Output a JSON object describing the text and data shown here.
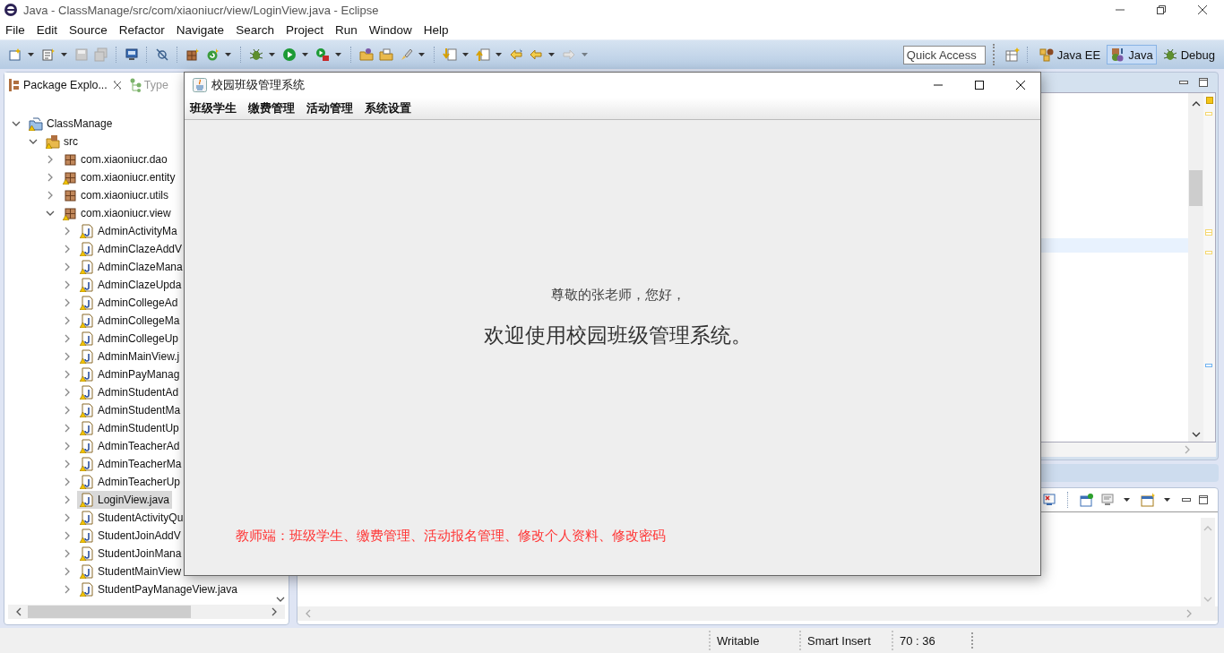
{
  "window": {
    "title": "Java - ClassManage/src/com/xiaoniucr/view/LoginView.java - Eclipse"
  },
  "menu_bar": [
    "File",
    "Edit",
    "Source",
    "Refactor",
    "Navigate",
    "Search",
    "Project",
    "Run",
    "Window",
    "Help"
  ],
  "quick_access": {
    "placeholder": "Quick Access"
  },
  "perspectives": [
    {
      "label": "Java EE",
      "selected": false
    },
    {
      "label": "Java",
      "selected": true
    },
    {
      "label": "Debug",
      "selected": false
    }
  ],
  "package_explorer": {
    "tabs": [
      {
        "label": "Package Explo...",
        "selected": true
      },
      {
        "label": "Type",
        "selected": false
      }
    ],
    "tree": [
      {
        "label": "ClassManage",
        "kind": "project",
        "expanded": true,
        "selected": false,
        "children": [
          {
            "label": "src",
            "kind": "folder",
            "expanded": true,
            "selected": false,
            "children": [
              {
                "label": "com.xiaoniucr.dao",
                "kind": "package",
                "expanded": false,
                "selected": false
              },
              {
                "label": "com.xiaoniucr.entity",
                "kind": "package",
                "expanded": false,
                "selected": false
              },
              {
                "label": "com.xiaoniucr.utils",
                "kind": "package",
                "expanded": false,
                "selected": false
              },
              {
                "label": "com.xiaoniucr.view",
                "kind": "package",
                "expanded": true,
                "selected": false,
                "children": [
                  {
                    "label": "AdminActivityMa",
                    "kind": "file",
                    "expanded": false,
                    "selected": false
                  },
                  {
                    "label": "AdminClazeAddV",
                    "kind": "file",
                    "expanded": false,
                    "selected": false
                  },
                  {
                    "label": "AdminClazeMana",
                    "kind": "file",
                    "expanded": false,
                    "selected": false
                  },
                  {
                    "label": "AdminClazeUpda",
                    "kind": "file",
                    "expanded": false,
                    "selected": false
                  },
                  {
                    "label": "AdminCollegeAd",
                    "kind": "file",
                    "expanded": false,
                    "selected": false
                  },
                  {
                    "label": "AdminCollegeMa",
                    "kind": "file",
                    "expanded": false,
                    "selected": false
                  },
                  {
                    "label": "AdminCollegeUp",
                    "kind": "file",
                    "expanded": false,
                    "selected": false
                  },
                  {
                    "label": "AdminMainView.j",
                    "kind": "file",
                    "expanded": false,
                    "selected": false
                  },
                  {
                    "label": "AdminPayManag",
                    "kind": "file",
                    "expanded": false,
                    "selected": false
                  },
                  {
                    "label": "AdminStudentAd",
                    "kind": "file",
                    "expanded": false,
                    "selected": false
                  },
                  {
                    "label": "AdminStudentMa",
                    "kind": "file",
                    "expanded": false,
                    "selected": false
                  },
                  {
                    "label": "AdminStudentUp",
                    "kind": "file",
                    "expanded": false,
                    "selected": false
                  },
                  {
                    "label": "AdminTeacherAd",
                    "kind": "file",
                    "expanded": false,
                    "selected": false
                  },
                  {
                    "label": "AdminTeacherMa",
                    "kind": "file",
                    "expanded": false,
                    "selected": false
                  },
                  {
                    "label": "AdminTeacherUp",
                    "kind": "file",
                    "expanded": false,
                    "selected": false
                  },
                  {
                    "label": "LoginView.java",
                    "kind": "file",
                    "expanded": false,
                    "selected": true
                  },
                  {
                    "label": "StudentActivityQu",
                    "kind": "file",
                    "expanded": false,
                    "selected": false
                  },
                  {
                    "label": "StudentJoinAddV",
                    "kind": "file",
                    "expanded": false,
                    "selected": false
                  },
                  {
                    "label": "StudentJoinMana",
                    "kind": "file",
                    "expanded": false,
                    "selected": false
                  },
                  {
                    "label": "StudentMainView",
                    "kind": "file",
                    "expanded": false,
                    "selected": false
                  },
                  {
                    "label": "StudentPayManageView.java",
                    "kind": "file",
                    "expanded": false,
                    "selected": false
                  }
                ]
              }
            ]
          }
        ]
      }
    ]
  },
  "dialog": {
    "title": "校园班级管理系统",
    "menu": [
      "班级学生",
      "缴费管理",
      "活动管理",
      "系统设置"
    ],
    "greeting": "尊敬的张老师，您好，",
    "welcome": "欢迎使用校园班级管理系统。",
    "footer": "教师端：班级学生、缴费管理、活动报名管理、修改个人资料、修改密码"
  },
  "status_bar": [
    "Writable",
    "Smart Insert",
    "70 : 36"
  ]
}
